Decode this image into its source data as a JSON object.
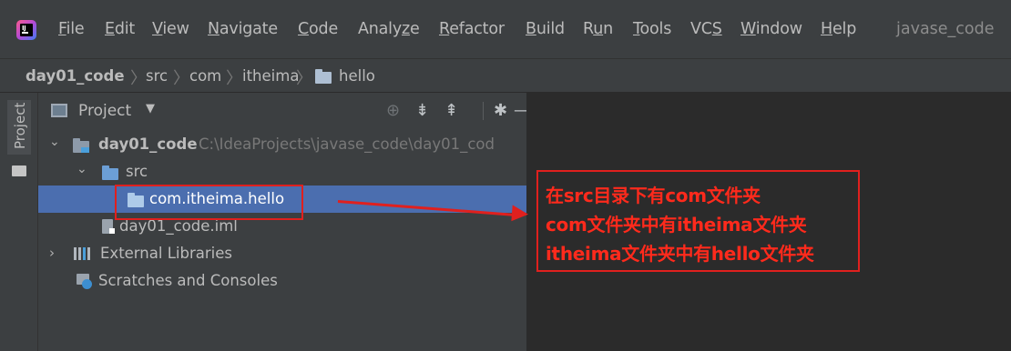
{
  "menu": {
    "items": [
      "File",
      "Edit",
      "View",
      "Navigate",
      "Code",
      "Analyze",
      "Refactor",
      "Build",
      "Run",
      "Tools",
      "VCS",
      "Window",
      "Help"
    ],
    "project_name": "javase_code"
  },
  "breadcrumb": [
    "day01_code",
    "src",
    "com",
    "itheima",
    "hello"
  ],
  "side_tab": "Project",
  "panel": {
    "title": "Project",
    "dropdown_glyph": "▼"
  },
  "tree": {
    "root_name": "day01_code",
    "root_path": "C:\\IdeaProjects\\javase_code\\day01_cod",
    "src": "src",
    "package": "com.itheima.hello",
    "iml": "day01_code.iml",
    "external_libraries": "External Libraries",
    "scratches": "Scratches and Consoles"
  },
  "annotation": {
    "lines": [
      "在src目录下有com文件夹",
      "com文件夹中有itheima文件夹",
      "itheima文件夹中有hello文件夹"
    ],
    "color": "#e0201e"
  },
  "colors": {
    "selection": "#4b6eaf",
    "folder_blue": "#6c9fd6",
    "background": "#2b2b2b"
  }
}
